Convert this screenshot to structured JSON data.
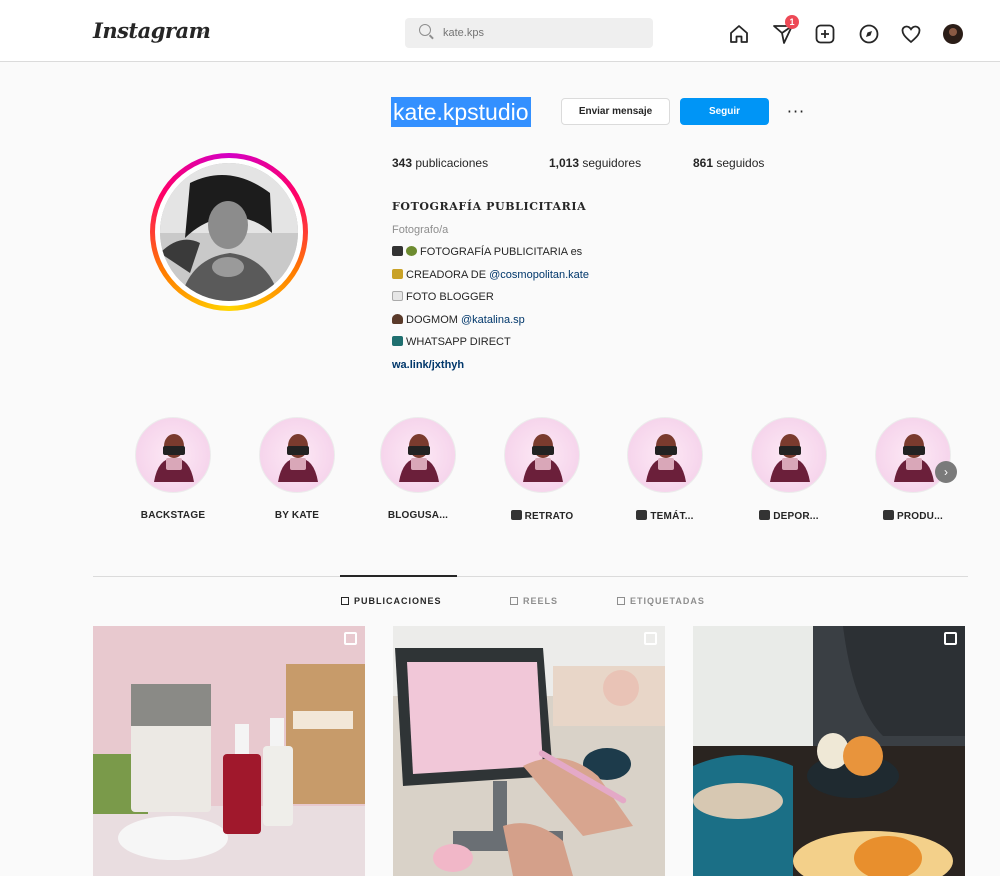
{
  "header": {
    "logo": "Instagram",
    "search_placeholder": "kate.kps",
    "notification_count": "1"
  },
  "profile": {
    "username": "kate.kpstudio",
    "message_button": "Enviar mensaje",
    "follow_button": "Seguir",
    "more_button": "···",
    "stats": [
      {
        "value": "343",
        "label": " publicaciones"
      },
      {
        "value": "1,013",
        "label": " seguidores"
      },
      {
        "value": "861",
        "label": " seguidos"
      }
    ],
    "bio": {
      "name": "FOTOGRAFÍA PUBLICITARIA",
      "category": "Fotografo/a",
      "line1": "FOTOGRAFÍA PUBLICITARIA es",
      "line2_prefix": "CREADORA DE ",
      "line2_link": "@cosmopolitan.kate",
      "line3": "FOTO BLOGGER",
      "line4_prefix": "DOGMOM ",
      "line4_link": "@katalina.sp",
      "line5": "WHATSAPP DIRECT",
      "website": "wa.link/jxthyh"
    }
  },
  "highlights": [
    {
      "label": "BACKSTAGE"
    },
    {
      "label": "BY KATE"
    },
    {
      "label": "BLOGUSA..."
    },
    {
      "label": "RETRATO"
    },
    {
      "label": "TEMÁT..."
    },
    {
      "label": "DEPOR..."
    },
    {
      "label": "PRODU..."
    }
  ],
  "tabs": [
    {
      "label": "PUBLICACIONES"
    },
    {
      "label": "REELS"
    },
    {
      "label": "ETIQUETADAS"
    }
  ],
  "colors": {
    "accent": "#0095f6",
    "selection": "#3390ff",
    "badge": "#ed4956",
    "highlight_bg": "#f6d5ec"
  }
}
